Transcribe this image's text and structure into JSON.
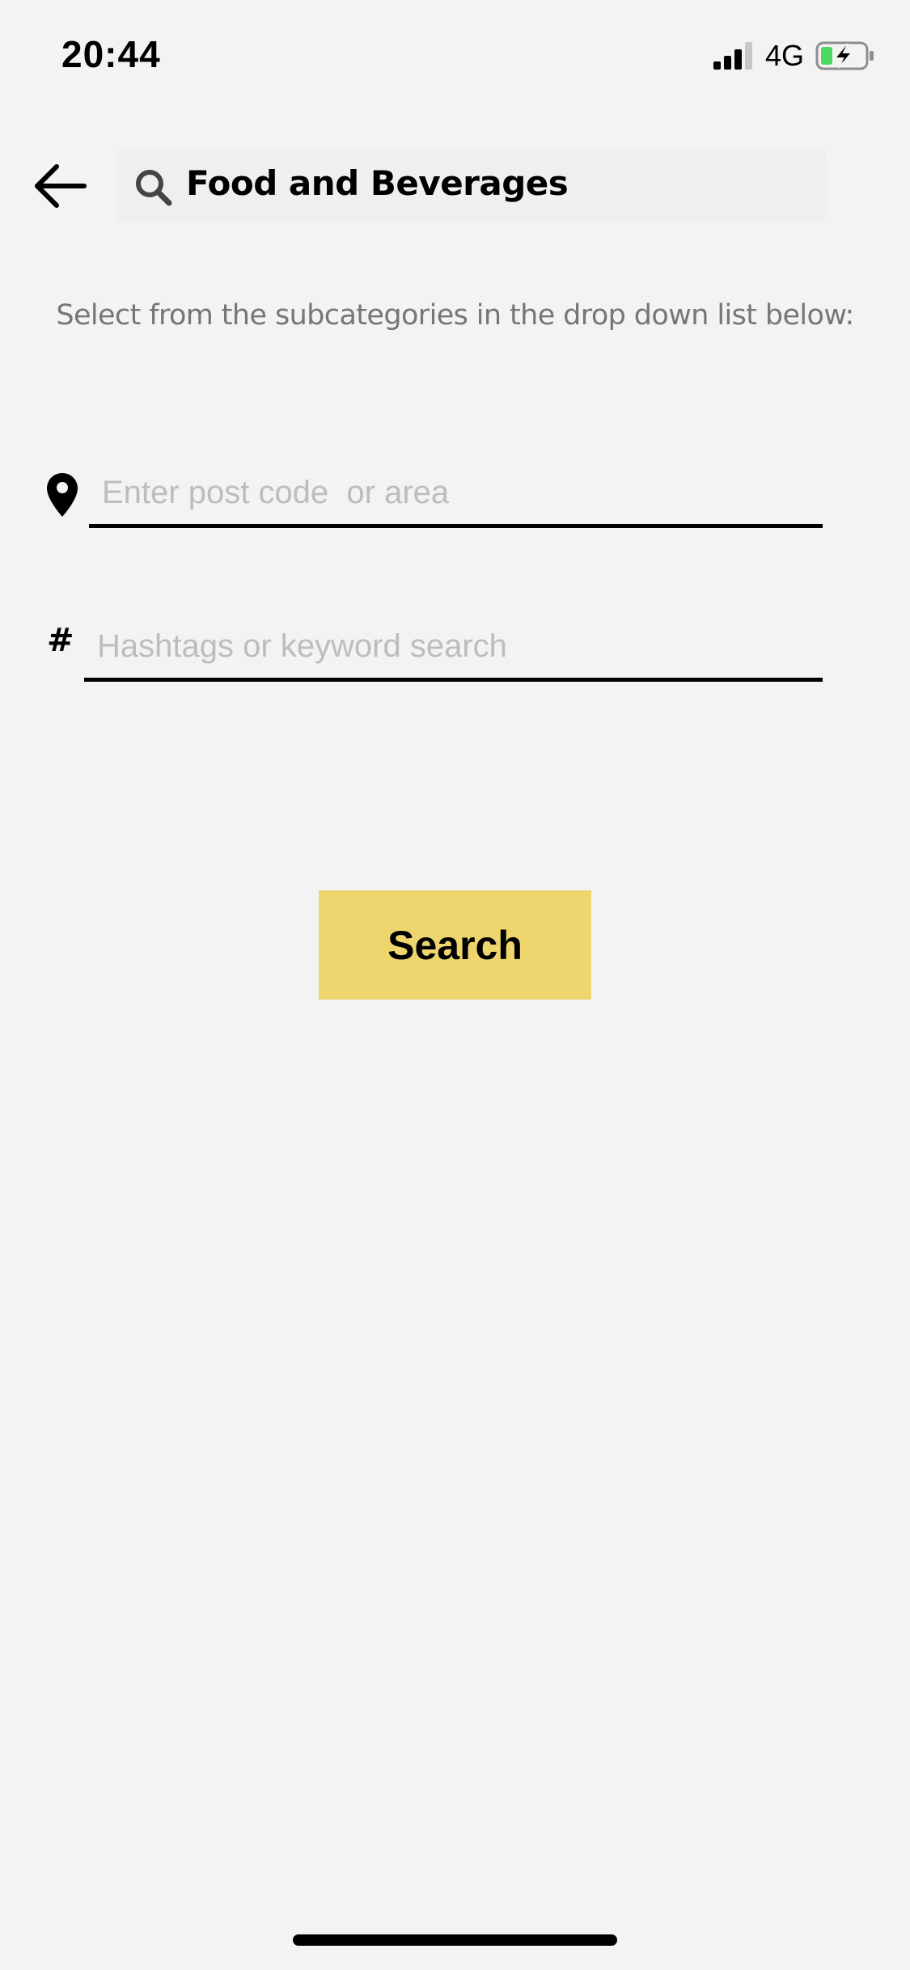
{
  "status_bar": {
    "time": "20:44",
    "network": "4G",
    "signal_icon": "cellular-signal-icon",
    "battery_icon": "battery-charging-icon",
    "battery_color": "#4cd964"
  },
  "header": {
    "back_icon": "arrow-left-icon",
    "search_icon": "search-icon",
    "title": "Food and Beverages"
  },
  "instructions": "Select from the subcategories in the drop down list below:",
  "location_field": {
    "icon": "map-pin-icon",
    "value": "",
    "placeholder": "Enter post code  or area"
  },
  "hashtag_field": {
    "icon": "hash-icon",
    "symbol": "#",
    "value": "",
    "placeholder": "Hashtags or keyword search"
  },
  "search_button": {
    "label": "Search",
    "color": "#efd56e"
  }
}
